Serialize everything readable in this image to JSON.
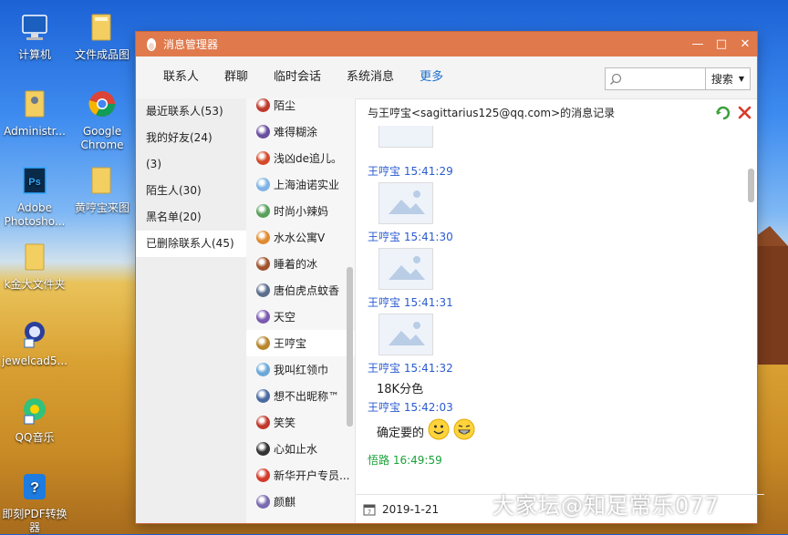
{
  "desktop": {
    "icons": [
      {
        "label": "计算机",
        "icon": "computer-icon"
      },
      {
        "label": "文件成品图",
        "icon": "folder-icon"
      },
      {
        "label": "Administr...",
        "icon": "user-folder-icon"
      },
      {
        "label": "Google Chrome",
        "icon": "chrome-icon"
      },
      {
        "label": "Adobe Photosho...",
        "icon": "photoshop-icon"
      },
      {
        "label": "黄哼宝来图",
        "icon": "folder-icon"
      },
      {
        "label": "k金大文件夹",
        "icon": "folder-icon"
      },
      {
        "label": "jewelcad5...",
        "icon": "jewelcad-icon"
      },
      {
        "label": "QQ音乐",
        "icon": "qqmusic-icon"
      },
      {
        "label": "即刻PDF转换器",
        "icon": "pdf-icon"
      }
    ],
    "watermark": "大家坛@知足常乐077"
  },
  "window": {
    "title": "消息管理器",
    "tabs": [
      "联系人",
      "群聊",
      "临时会话",
      "系统消息",
      "更多"
    ],
    "active_tab": "更多",
    "search": {
      "placeholder": "",
      "button_label": "搜索"
    },
    "groups": [
      "最近联系人(53)",
      "我的好友(24)",
      "(3)",
      "陌生人(30)",
      "黑名单(20)",
      "已删除联系人(45)"
    ],
    "selected_group": "已删除联系人(45)",
    "contacts": [
      {
        "name": "陌尘",
        "color": "#c0392b"
      },
      {
        "name": "难得糊涂",
        "color": "#6a4fa0"
      },
      {
        "name": "浅凶de追儿。",
        "color": "#d34a2a"
      },
      {
        "name": "上海油诺实业",
        "color": "#7fb3e6"
      },
      {
        "name": "时尚小辣妈",
        "color": "#58a05a"
      },
      {
        "name": "水水公寓V",
        "color": "#e08a30"
      },
      {
        "name": "睡着的冰",
        "color": "#a0522d"
      },
      {
        "name": "唐伯虎点蚊香",
        "color": "#5a6e8c"
      },
      {
        "name": "天空",
        "color": "#7a5ab0"
      },
      {
        "name": "王哼宝",
        "color": "#b8862c"
      },
      {
        "name": "我叫红领巾",
        "color": "#6aa8d8"
      },
      {
        "name": "想不出昵称™",
        "color": "#4a6aa0"
      },
      {
        "name": "笑笑",
        "color": "#c0392b"
      },
      {
        "name": "心如止水",
        "color": "#333333"
      },
      {
        "name": "新华开户专员...",
        "color": "#d33a2a"
      },
      {
        "name": "颜麒",
        "color": "#7a6ab0"
      }
    ],
    "selected_contact": "王哼宝",
    "record_title": "与王哼宝<sagittarius125@qq.com>的消息记录",
    "messages": [
      {
        "sender": "王哼宝",
        "time": "15:41:29",
        "kind": "image"
      },
      {
        "sender": "王哼宝",
        "time": "15:41:30",
        "kind": "image"
      },
      {
        "sender": "王哼宝",
        "time": "15:41:31",
        "kind": "image"
      },
      {
        "sender": "王哼宝",
        "time": "15:41:32",
        "kind": "text",
        "text": "18K分色"
      },
      {
        "sender": "王哼宝",
        "time": "15:42:03",
        "kind": "text",
        "text": "确定要的"
      },
      {
        "sender": "悟路",
        "time": "16:49:59",
        "kind": "me"
      }
    ],
    "date": "2019-1-21",
    "colors": {
      "titlebar": "#e07a4c",
      "accent": "#1a6fd0",
      "sender": "#2a5bd0",
      "me": "#1aa23a"
    }
  }
}
